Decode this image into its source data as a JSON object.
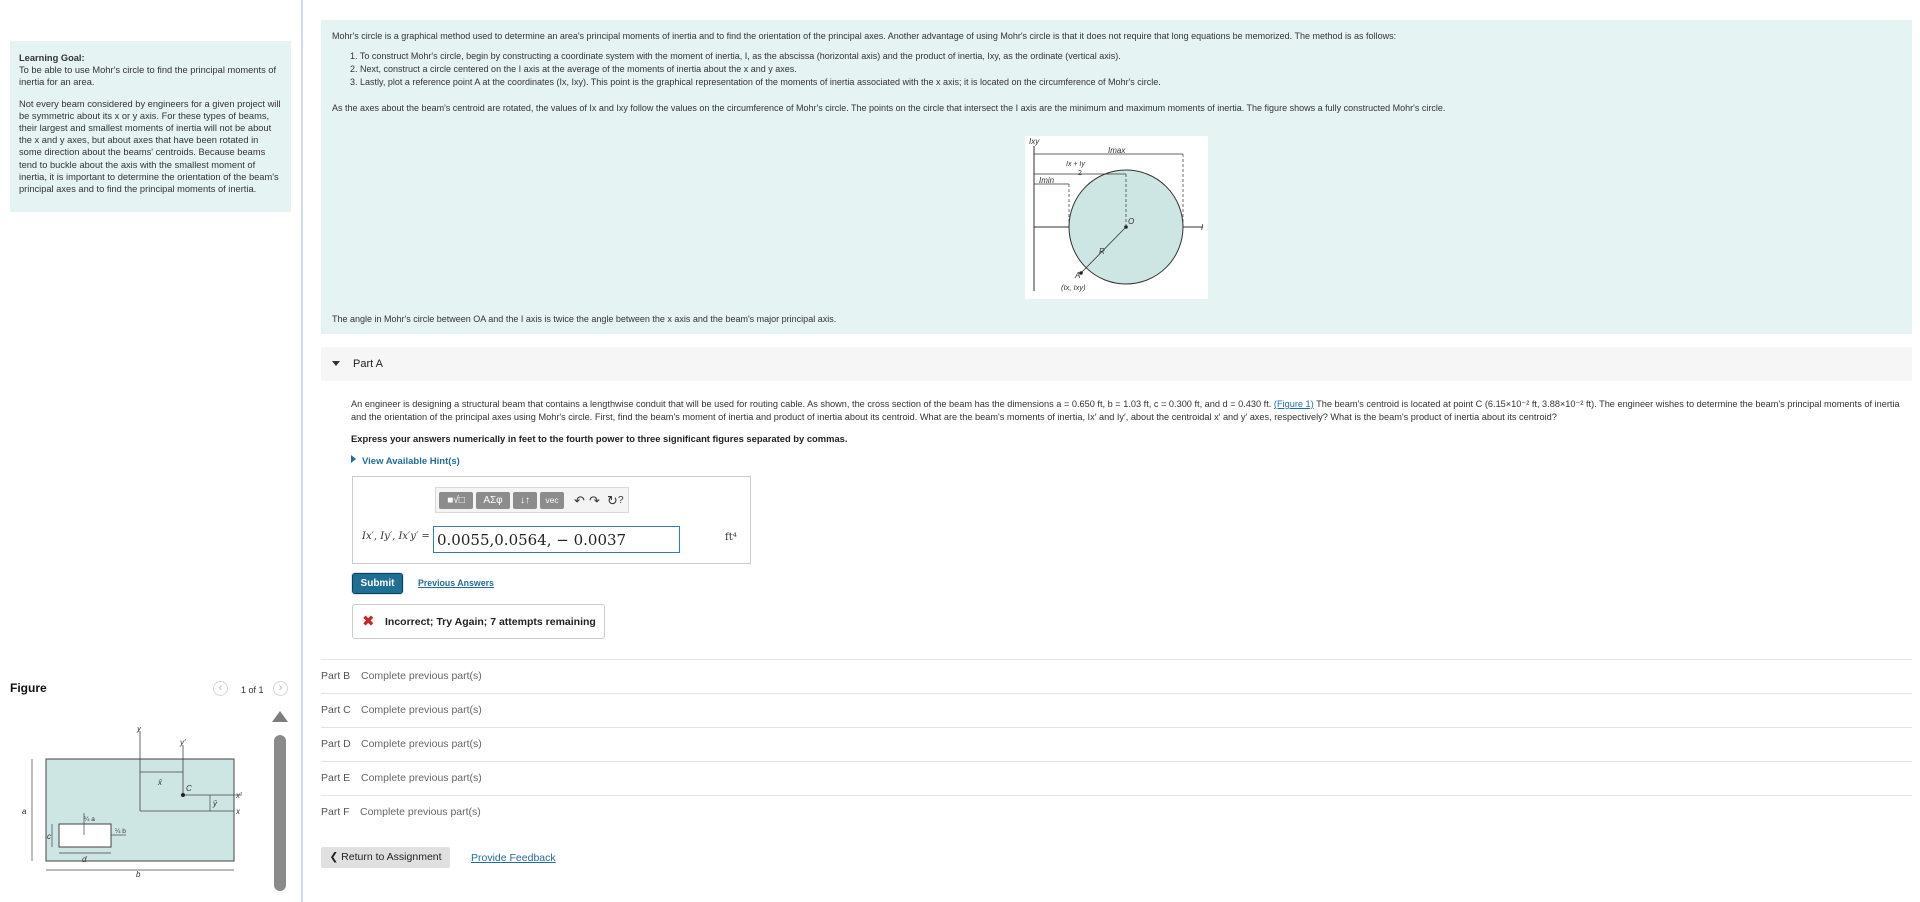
{
  "sidebar": {
    "goal_title": "Learning Goal:",
    "goal_text": "To be able to use Mohr's circle to find the principal moments of inertia for an area.",
    "goal_paragraph": "Not every beam considered by engineers for a given project will be symmetric about its x or y axis. For these types of beams, their largest and smallest moments of inertia will not be about the x and y axes, but about axes that have been rotated in some direction about the beams' centroids. Because beams tend to buckle about the axis with the smallest moment of inertia, it is important to determine the orientation of the beam's principal axes and to find the principal moments of inertia.",
    "figure_title": "Figure",
    "figure_count": "1 of 1",
    "figure_labels": {
      "y": "y",
      "yprime": "y′",
      "x": "x",
      "xprime": "x′",
      "C": "C",
      "a": "a",
      "b": "b",
      "c": "c",
      "d": "d",
      "xbar": "x̄",
      "ybar": "ȳ",
      "qa": "¼ a",
      "qb": "¼ b"
    }
  },
  "intro": {
    "line1": "Mohr's circle is a graphical method used to determine an area's principal moments of inertia and to find the orientation of the principal axes. Another advantage of using Mohr's circle is that it does not require that long equations be memorized. The method is as follows:",
    "steps": [
      "1. To construct Mohr's circle, begin by constructing a coordinate system with the moment of inertia, I, as the abscissa (horizontal axis) and the product of inertia, Ixy, as the ordinate (vertical axis).",
      "2. Next, construct a circle centered on the I axis at the average of the moments of inertia about the x and y axes.",
      "3. Lastly, plot a reference point A at the coordinates (Ix, Ixy). This point is the graphical representation of the moments of inertia associated with the x axis; it is located on the circumference of Mohr's circle."
    ],
    "line2": "As the axes about the beam's centroid are rotated, the values of Ix and Ixy follow the values on the circumference of Mohr's circle. The points on the circle that intersect the I axis are the minimum and maximum moments of inertia. The figure shows a fully constructed Mohr's circle.",
    "line3": "The angle in Mohr's circle between OA and the I axis is twice the angle between the x axis and the beam's major principal axis.",
    "mohr_labels": {
      "ixy": "Ixy",
      "imax": "Imax",
      "imin": "Imin",
      "avg_top": "Ix + Iy",
      "avg_bot": "2",
      "O": "O",
      "R": "R",
      "A": "A",
      "I": "I",
      "coords": "(Ix, Ixy)"
    }
  },
  "part_a": {
    "label": "Part A",
    "problem_pre": "An engineer is designing a structural beam that contains a lengthwise conduit that will be used for routing cable. As shown, the cross section of the beam has the dimensions a = 0.650 ft, b = 1.03 ft, c = 0.300 ft, and d = 0.430 ft. ",
    "figure_link": "(Figure 1)",
    "problem_post": " The beam's centroid is located at point C (6.15×10⁻² ft, 3.88×10⁻² ft). The engineer wishes to determine the beam's principal moments of inertia and the orientation of the principal axes using Mohr's circle. First, find the beam's moment of inertia and product of inertia about its centroid. What are the beam's moments of inertia, Ix′ and Iy′, about the centroidal x′ and y′ axes, respectively? What is the beam's product of inertia about its centroid?",
    "express": "Express your answers numerically in feet to the fourth power to three significant figures separated by commas.",
    "hints": "View Available Hint(s)",
    "toolbar": {
      "templates": "■√□",
      "greek": "AΣφ",
      "arrows": "↓↑",
      "vec": "vec",
      "help": "?"
    },
    "answer_label": "Ix′, Iy′, Ix′y′ =",
    "answer_value": "0.0055,0.0564, − 0.0037",
    "answer_unit": "ft⁴",
    "submit": "Submit",
    "previous_answers": "Previous Answers",
    "feedback": "Incorrect; Try Again; 7 attempts remaining"
  },
  "parts": [
    {
      "label": "Part B",
      "status": "Complete previous part(s)"
    },
    {
      "label": "Part C",
      "status": "Complete previous part(s)"
    },
    {
      "label": "Part D",
      "status": "Complete previous part(s)"
    },
    {
      "label": "Part E",
      "status": "Complete previous part(s)"
    },
    {
      "label": "Part F",
      "status": "Complete previous part(s)"
    }
  ],
  "footer": {
    "return": "❮ Return to Assignment",
    "feedback": "Provide Feedback"
  },
  "colors": {
    "panel": "#e6f3f3",
    "link": "#1f6d9d",
    "submit": "#1f6e93",
    "error": "#c62828",
    "circle_fill": "#cde5e3"
  }
}
